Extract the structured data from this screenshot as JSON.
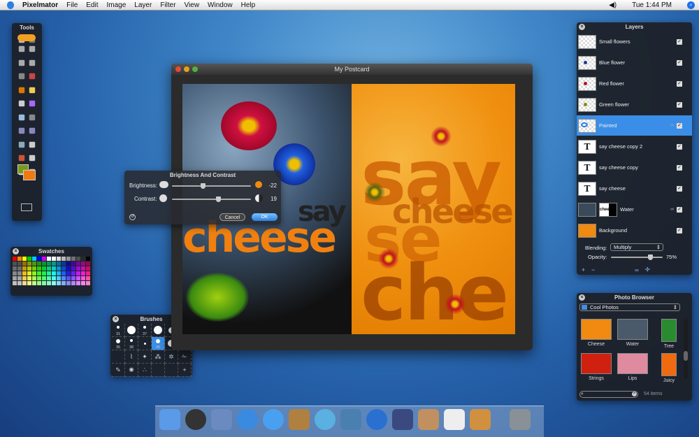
{
  "menubar": {
    "app": "Pixelmator",
    "items": [
      "File",
      "Edit",
      "Image",
      "Layer",
      "Filter",
      "View",
      "Window",
      "Help"
    ],
    "clock": "Tue 1:44 PM",
    "icons": [
      "apple-icon",
      "volume-icon",
      "spotlight-icon"
    ]
  },
  "tools": {
    "title": "Tools",
    "foreground_color": "#7a9a1a",
    "background_color": "#f07a10"
  },
  "swatches": {
    "title": "Swatches"
  },
  "brushes": {
    "title": "Brushes",
    "sizes": [
      "31",
      "",
      "37",
      "",
      "",
      "",
      "35",
      "38",
      "",
      "30",
      "",
      ""
    ],
    "selected_index": 9
  },
  "document": {
    "title": "My Postcard",
    "canvas_words": [
      "say",
      "cheese",
      "se",
      "che",
      "cheese",
      "say"
    ]
  },
  "dialog": {
    "title": "Brightness And Contrast",
    "brightness_label": "Brightness:",
    "brightness_value": "-22",
    "brightness": -22,
    "contrast_label": "Contrast:",
    "contrast_value": "19",
    "contrast": 19,
    "cancel": "Cancel",
    "ok": "OK"
  },
  "layers": {
    "title": "Layers",
    "items": [
      {
        "name": "Small flowers",
        "visible": true
      },
      {
        "name": "Blue flower",
        "visible": true
      },
      {
        "name": "Red flower",
        "visible": true
      },
      {
        "name": "Green flower",
        "visible": true
      },
      {
        "name": "Painted",
        "visible": true,
        "selected": true,
        "linked": true
      },
      {
        "name": "say cheese copy 2",
        "visible": true,
        "type": "text"
      },
      {
        "name": "say cheese copy",
        "visible": true,
        "type": "text"
      },
      {
        "name": "say cheese",
        "visible": true,
        "type": "text"
      },
      {
        "name": "Water",
        "visible": true,
        "linked": true,
        "mask_text": "chee"
      },
      {
        "name": "Background",
        "visible": true
      }
    ],
    "blending_label": "Blending:",
    "blending_value": "Multiply",
    "opacity_label": "Opacity:",
    "opacity_value": "75%",
    "opacity": 75,
    "selection_color": "#3a8ee8"
  },
  "photo_browser": {
    "title": "Photo Browser",
    "source": "Cool Photos",
    "items": [
      "Cheese",
      "Water",
      "Tree",
      "Strings",
      "Lips",
      "Juicy"
    ],
    "count": "54 items"
  },
  "dock": {
    "apps": [
      "finder",
      "dashboard",
      "mail",
      "safari",
      "ichat",
      "address-book",
      "itunes",
      "iphoto",
      "idvd",
      "imovie",
      "preview",
      "ical",
      "pixelmator",
      "trash"
    ]
  }
}
